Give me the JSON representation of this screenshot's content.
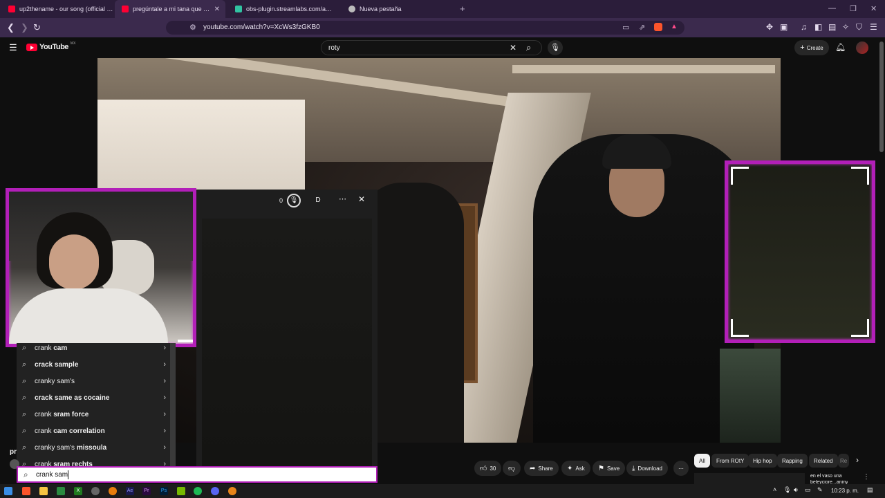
{
  "browser": {
    "tabs": [
      {
        "title": "up2thename - our song (official vide",
        "fav_color": "#ff0033",
        "active": false
      },
      {
        "title": "pregúntale a mi tana que no me",
        "fav_color": "#ff0033",
        "active": true
      },
      {
        "title": "obs-plugin.streamlabs.com/auth/suc",
        "fav_color": "#31c3a2",
        "active": false
      },
      {
        "title": "Nueva pestaña",
        "fav_color": "#bbbbbb",
        "active": false
      }
    ],
    "new_tab_symbol": "+",
    "url": "youtube.com/watch?v=XcWs3fzGKB0",
    "accent": "#b21fb8"
  },
  "youtube": {
    "logo_text": "YouTube",
    "region": "MX",
    "search_value": "roty",
    "create_label": "Create"
  },
  "panel": {
    "counter": "0",
    "avatar_letter": "D"
  },
  "suggestions": [
    {
      "prefix": "crank",
      "bold": " cam"
    },
    {
      "prefix": "",
      "bold": "crack sample"
    },
    {
      "prefix": "cranky sam's",
      "bold": ""
    },
    {
      "prefix": "",
      "bold": "crack",
      "rest": " same as cocaine"
    },
    {
      "prefix": "crank",
      "bold": " sram force"
    },
    {
      "prefix": "crank",
      "bold": " cam correlation"
    },
    {
      "prefix": "cranky sam's",
      "bold": " missoula"
    },
    {
      "prefix": "crank",
      "bold": " sram rechts"
    }
  ],
  "search_box_value": "crank sam",
  "channel_fragment": "pr",
  "actions": {
    "likes": "30",
    "share": "Share",
    "ask": "Ask",
    "save": "Save",
    "download": "Download"
  },
  "chips": [
    "All",
    "From ROtY",
    "Hip hop",
    "Rapping",
    "Related",
    "Re"
  ],
  "sidebar_video_title": "en el vaso una",
  "sidebar_video_title_2": "beleyciore...aniny",
  "taskbar": {
    "time": "10:23 p. m."
  }
}
